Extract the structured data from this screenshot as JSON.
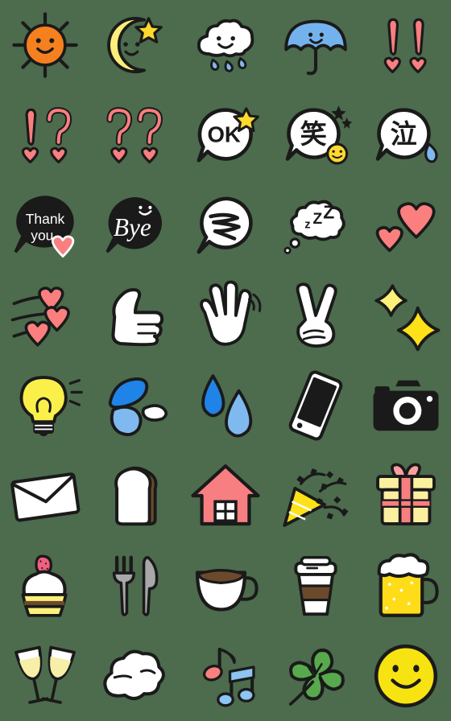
{
  "sheet": {
    "title": "Cute Doodle Emoji Sticker Sheet",
    "background_color": "#4d6b4d",
    "columns": 5,
    "rows": 8,
    "total_stickers": 40
  },
  "palette": {
    "outline": "#1a1a1a",
    "white": "#ffffff",
    "sun_orange": "#f58020",
    "moon_yellow": "#fbee7a",
    "star_yellow": "#ffd92e",
    "umbrella_blue": "#74b2ee",
    "heart_pink": "#fb7f7f",
    "water_blue": "#1f83e8",
    "water_light": "#7fb9f0",
    "bulb_yellow": "#fbf04a",
    "house_pink": "#f77f81",
    "gift_yellow": "#fbf0a0",
    "beer_yellow": "#ffdc18",
    "clover_green": "#58a94d",
    "smiley_yellow": "#f7e312",
    "coffee_brown": "#6b4a2c",
    "bread_crust": "#6b4a2c",
    "cutlery_gray": "#a8a8a8",
    "champagne": "#f7eea8",
    "note_pink": "#fb7f7f",
    "note_blue": "#8cc4f2",
    "sparkle_yellow": "#ffe11a"
  },
  "stickers": [
    {
      "row": 1,
      "col": 1,
      "name": "sun",
      "label": "Smiling sun",
      "text": ""
    },
    {
      "row": 1,
      "col": 2,
      "name": "moon-star",
      "label": "Crescent moon with star",
      "text": ""
    },
    {
      "row": 1,
      "col": 3,
      "name": "rain-cloud",
      "label": "Smiling rain cloud",
      "text": ""
    },
    {
      "row": 1,
      "col": 4,
      "name": "umbrella",
      "label": "Blue umbrella",
      "text": ""
    },
    {
      "row": 1,
      "col": 5,
      "name": "double-exclamation",
      "label": "Double exclamation with hearts",
      "text": "!!"
    },
    {
      "row": 2,
      "col": 1,
      "name": "exclamation-question",
      "label": "Exclamation question with hearts",
      "text": "!?"
    },
    {
      "row": 2,
      "col": 2,
      "name": "double-question",
      "label": "Double question with hearts",
      "text": "??"
    },
    {
      "row": 2,
      "col": 3,
      "name": "ok-bubble",
      "label": "OK speech bubble with star",
      "text": "OK"
    },
    {
      "row": 2,
      "col": 4,
      "name": "warau-bubble",
      "label": "Laugh kanji bubble with smiley",
      "text": "笑"
    },
    {
      "row": 2,
      "col": 5,
      "name": "naku-bubble",
      "label": "Cry kanji bubble with teardrop",
      "text": "泣"
    },
    {
      "row": 3,
      "col": 1,
      "name": "thank-you-bubble",
      "label": "Thank you bubble with heart",
      "text": "Thank you"
    },
    {
      "row": 3,
      "col": 2,
      "name": "bye-bubble",
      "label": "Bye bubble with smiley",
      "text": "Bye"
    },
    {
      "row": 3,
      "col": 3,
      "name": "swirl-bubble",
      "label": "Swirl confusion bubble",
      "text": ""
    },
    {
      "row": 3,
      "col": 4,
      "name": "zzz-cloud",
      "label": "Sleeping zzz thought cloud",
      "text": "zZZ"
    },
    {
      "row": 3,
      "col": 5,
      "name": "two-hearts",
      "label": "Two pink hearts",
      "text": ""
    },
    {
      "row": 4,
      "col": 1,
      "name": "flying-hearts",
      "label": "Flying hearts with motion lines",
      "text": ""
    },
    {
      "row": 4,
      "col": 2,
      "name": "thumbs-up",
      "label": "Thumbs up hand",
      "text": ""
    },
    {
      "row": 4,
      "col": 3,
      "name": "waving-hand",
      "label": "Waving open hand",
      "text": ""
    },
    {
      "row": 4,
      "col": 4,
      "name": "peace-sign",
      "label": "Peace sign hand",
      "text": ""
    },
    {
      "row": 4,
      "col": 5,
      "name": "sparkles",
      "label": "Yellow sparkles",
      "text": ""
    },
    {
      "row": 5,
      "col": 1,
      "name": "light-bulb",
      "label": "Glowing light bulb",
      "text": ""
    },
    {
      "row": 5,
      "col": 2,
      "name": "water-splash",
      "label": "Blue water splash",
      "text": ""
    },
    {
      "row": 5,
      "col": 3,
      "name": "water-drops",
      "label": "Two water droplets",
      "text": ""
    },
    {
      "row": 5,
      "col": 4,
      "name": "smartphone",
      "label": "Tilted smartphone",
      "text": ""
    },
    {
      "row": 5,
      "col": 5,
      "name": "camera",
      "label": "Black camera",
      "text": ""
    },
    {
      "row": 6,
      "col": 1,
      "name": "envelope",
      "label": "Mail envelope",
      "text": ""
    },
    {
      "row": 6,
      "col": 2,
      "name": "bread-slice",
      "label": "Slice of bread",
      "text": ""
    },
    {
      "row": 6,
      "col": 3,
      "name": "house",
      "label": "Pink house",
      "text": ""
    },
    {
      "row": 6,
      "col": 4,
      "name": "party-popper",
      "label": "Party popper confetti",
      "text": ""
    },
    {
      "row": 6,
      "col": 5,
      "name": "gift-box",
      "label": "Gift box with ribbon",
      "text": ""
    },
    {
      "row": 7,
      "col": 1,
      "name": "cupcake",
      "label": "Cupcake with strawberry",
      "text": ""
    },
    {
      "row": 7,
      "col": 2,
      "name": "fork-knife",
      "label": "Fork and knife",
      "text": ""
    },
    {
      "row": 7,
      "col": 3,
      "name": "coffee-cup",
      "label": "Cup of coffee",
      "text": ""
    },
    {
      "row": 7,
      "col": 4,
      "name": "takeout-coffee",
      "label": "Takeout coffee cup",
      "text": ""
    },
    {
      "row": 7,
      "col": 5,
      "name": "beer-mug",
      "label": "Beer mug with foam",
      "text": ""
    },
    {
      "row": 8,
      "col": 1,
      "name": "champagne-toast",
      "label": "Two champagne glasses toasting",
      "text": ""
    },
    {
      "row": 8,
      "col": 2,
      "name": "smoke-puff",
      "label": "Puff of smoke",
      "text": ""
    },
    {
      "row": 8,
      "col": 3,
      "name": "music-notes",
      "label": "Music notes",
      "text": ""
    },
    {
      "row": 8,
      "col": 4,
      "name": "four-leaf-clover",
      "label": "Four leaf clover",
      "text": ""
    },
    {
      "row": 8,
      "col": 5,
      "name": "smiley-face",
      "label": "Yellow smiley face",
      "text": ""
    }
  ]
}
